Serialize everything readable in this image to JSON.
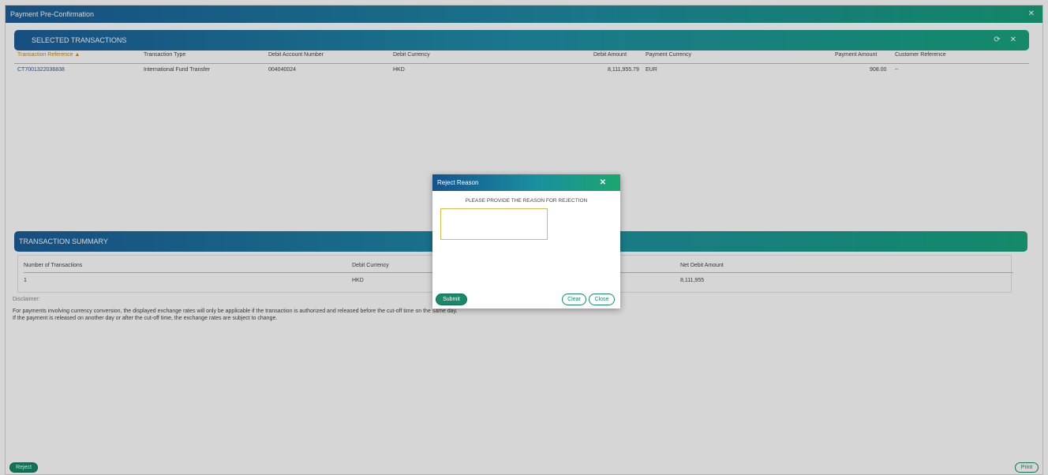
{
  "window": {
    "title": "Payment Pre-Confirmation",
    "close_icon": "close-icon"
  },
  "selected_transactions": {
    "title": "SELECTED TRANSACTIONS",
    "columns": [
      "Transaction Reference ▲",
      "Transaction Type",
      "Debit Account Number",
      "Debit Currency",
      "Debit Amount",
      "Payment Currency",
      "Payment Amount",
      "Customer Reference"
    ],
    "rows": [
      [
        "CT7001322036838",
        "International Fund Transfer",
        "004040024",
        "HKD",
        "8,111,955.79",
        "EUR",
        "908.00",
        "--"
      ]
    ]
  },
  "transaction_summary": {
    "title": "TRANSACTION SUMMARY",
    "columns": [
      "Number of Transactions",
      "Debit Currency",
      "Net Debit Amount"
    ],
    "values": [
      "1",
      "HKD",
      "8,111,955"
    ]
  },
  "disclaimer": {
    "heading": "Disclaimer:",
    "line1": "For payments involving currency conversion, the displayed exchange rates will only be applicable if the transaction is authorized and released before the cut-off time on the same day.",
    "line2": "If the payment is released on another day or after the cut-off time, the exchange rates are subject to change."
  },
  "footer": {
    "reject_label": "Reject",
    "print_label": "Print"
  },
  "modal": {
    "title": "Reject Reason",
    "instruction": "PLEASE PROVIDE THE REASON FOR REJECTION",
    "reason_value": "",
    "submit_label": "Submit",
    "clear_label": "Clear",
    "close_label": "Close"
  },
  "colors": {
    "accent": "#178a6b",
    "header_start": "#1c5e99",
    "header_end": "#18a57e",
    "link": "#1a5fb4"
  }
}
